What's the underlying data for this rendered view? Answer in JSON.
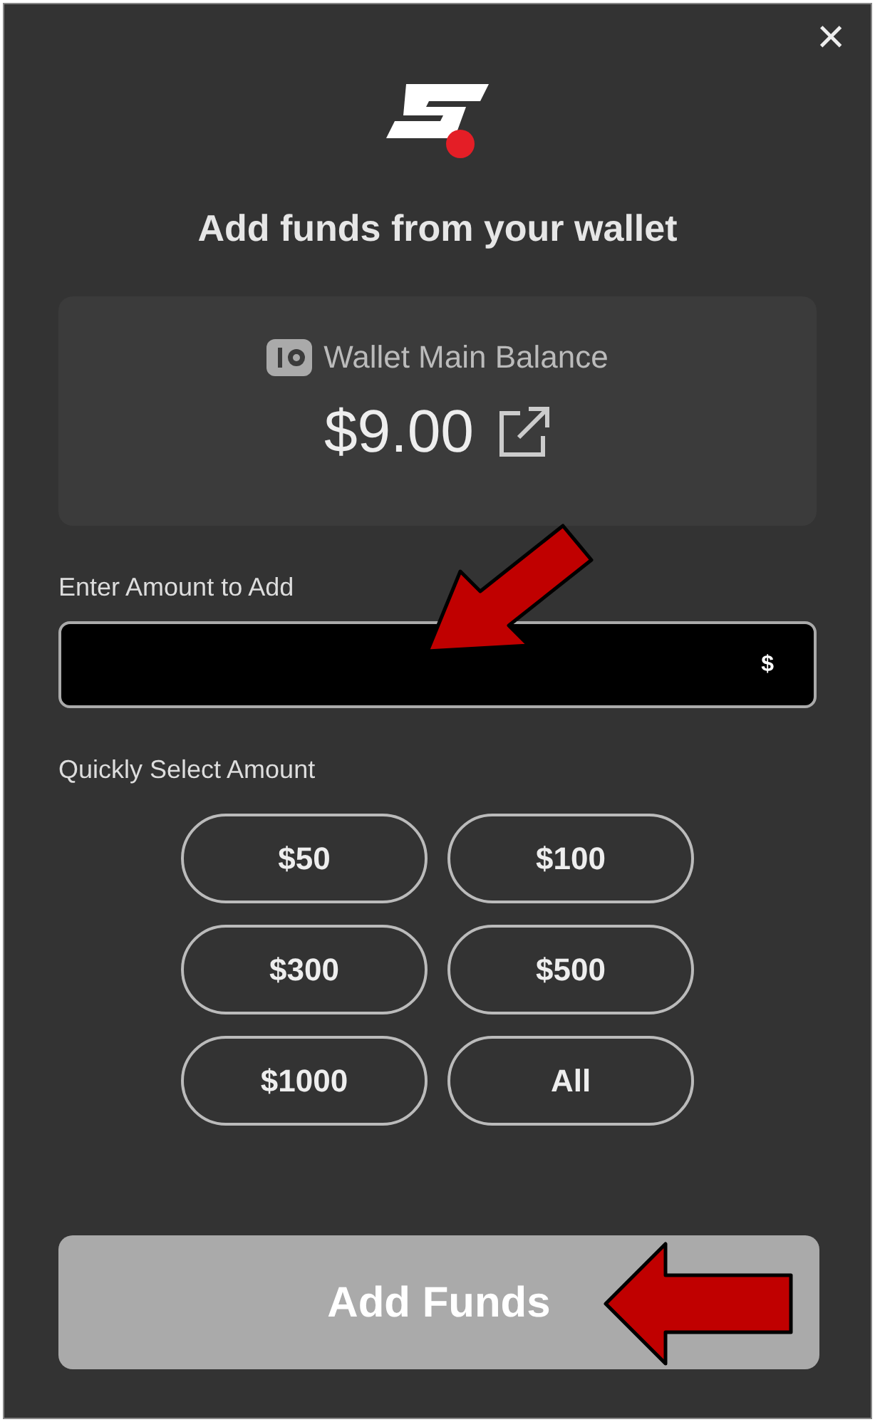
{
  "dialog": {
    "close": "×",
    "title": "Add funds from your wallet"
  },
  "wallet": {
    "label": "Wallet Main Balance",
    "balance": "$9.00"
  },
  "amount_field": {
    "label": "Enter Amount to Add",
    "currency": "$"
  },
  "quick_select": {
    "label": "Quickly Select Amount",
    "amounts": [
      "$50",
      "$100",
      "$300",
      "$500",
      "$1000",
      "All"
    ]
  },
  "submit": {
    "label": "Add Funds",
    "disabled": true
  }
}
